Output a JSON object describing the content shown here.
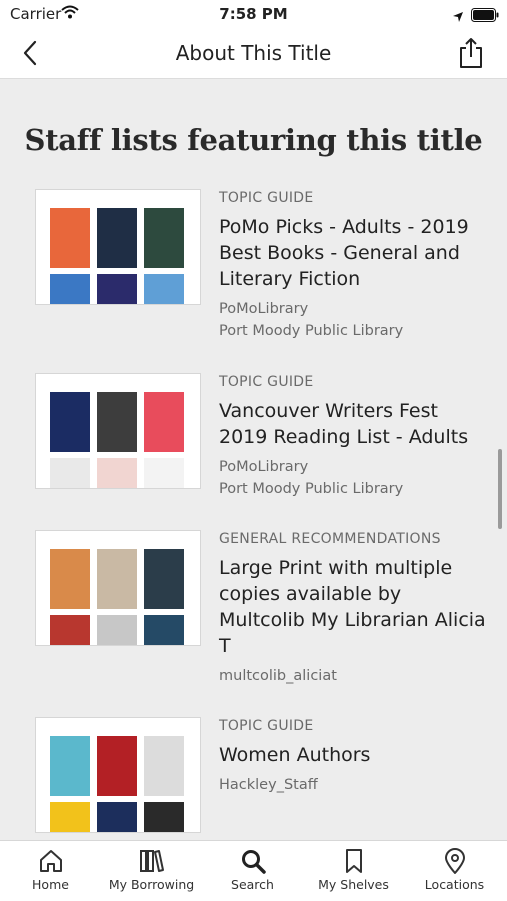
{
  "status_bar": {
    "carrier": "Carrier",
    "time": "7:58 PM"
  },
  "nav": {
    "title": "About This Title"
  },
  "section": {
    "title": "Staff lists featuring this title"
  },
  "lists": [
    {
      "kind": "TOPIC GUIDE",
      "title": "PoMo Picks - Adults - 2019 Best Books - General and Literary Fiction",
      "owner": "PoMoLibrary",
      "library": "Port Moody Public Library",
      "cover_colors": [
        "#e8673b",
        "#1f2e45",
        "#2d4a3e",
        "#3b78c4",
        "#2b2b6b",
        "#5f9fd6"
      ]
    },
    {
      "kind": "TOPIC GUIDE",
      "title": "Vancouver Writers Fest 2019 Reading List - Adults",
      "owner": "PoMoLibrary",
      "library": "Port Moody Public Library",
      "cover_colors": [
        "#1b2c63",
        "#3d3d3d",
        "#e84c5c",
        "#e9e9e9",
        "#f1d5d1",
        "#f3f3f3"
      ]
    },
    {
      "kind": "GENERAL RECOMMENDATIONS",
      "title": "Large Print with multiple copies available by Multcolib My Librarian Alicia T",
      "owner": "multcolib_aliciat",
      "library": "",
      "cover_colors": [
        "#d98a4a",
        "#c9b9a4",
        "#2b3d4a",
        "#b8372f",
        "#c7c7c7",
        "#254a66"
      ]
    },
    {
      "kind": "TOPIC GUIDE",
      "title": "Women Authors",
      "owner": "Hackley_Staff",
      "library": "",
      "cover_colors": [
        "#5bb8cc",
        "#b32025",
        "#dcdcdc",
        "#f2c21b",
        "#1c2e5c",
        "#2a2a2a"
      ]
    }
  ],
  "tabs": [
    {
      "label": "Home",
      "icon": "home-icon"
    },
    {
      "label": "My Borrowing",
      "icon": "books-icon"
    },
    {
      "label": "Search",
      "icon": "search-icon"
    },
    {
      "label": "My Shelves",
      "icon": "bookmark-icon"
    },
    {
      "label": "Locations",
      "icon": "location-pin-icon"
    }
  ]
}
